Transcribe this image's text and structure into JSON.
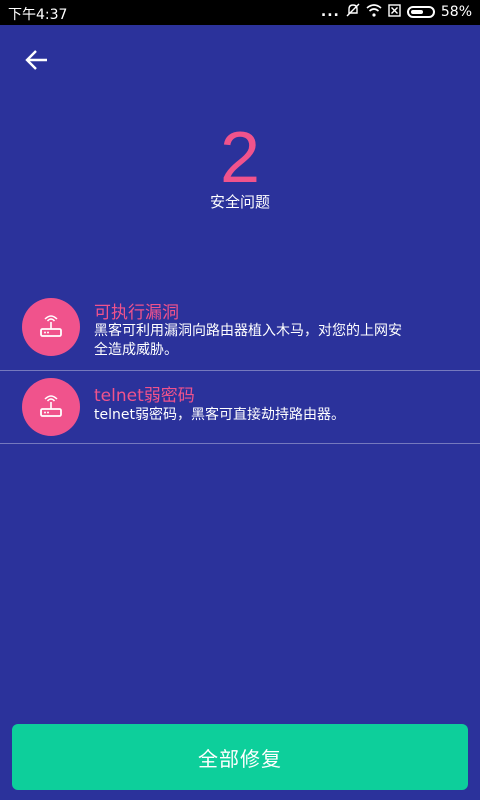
{
  "status_bar": {
    "time": "下午4:37",
    "dots": "...",
    "battery_text": "58%",
    "battery_level": 0.58
  },
  "header": {
    "back_icon": "arrow-left-icon"
  },
  "summary": {
    "count": "2",
    "label": "安全问题"
  },
  "issues": [
    {
      "title": "可执行漏洞",
      "description": "黑客可利用漏洞向路由器植入木马，对您的上网安全造成威胁。",
      "icon": "router-icon"
    },
    {
      "title": "telnet弱密码",
      "description": "telnet弱密码，黑客可直接劫持路由器。",
      "icon": "router-icon"
    }
  ],
  "footer": {
    "fix_all_label": "全部修复"
  },
  "colors": {
    "background": "#2B329B",
    "accent_pink": "#F0538C",
    "button_green": "#0DCF9B",
    "status_bar": "#000000"
  }
}
